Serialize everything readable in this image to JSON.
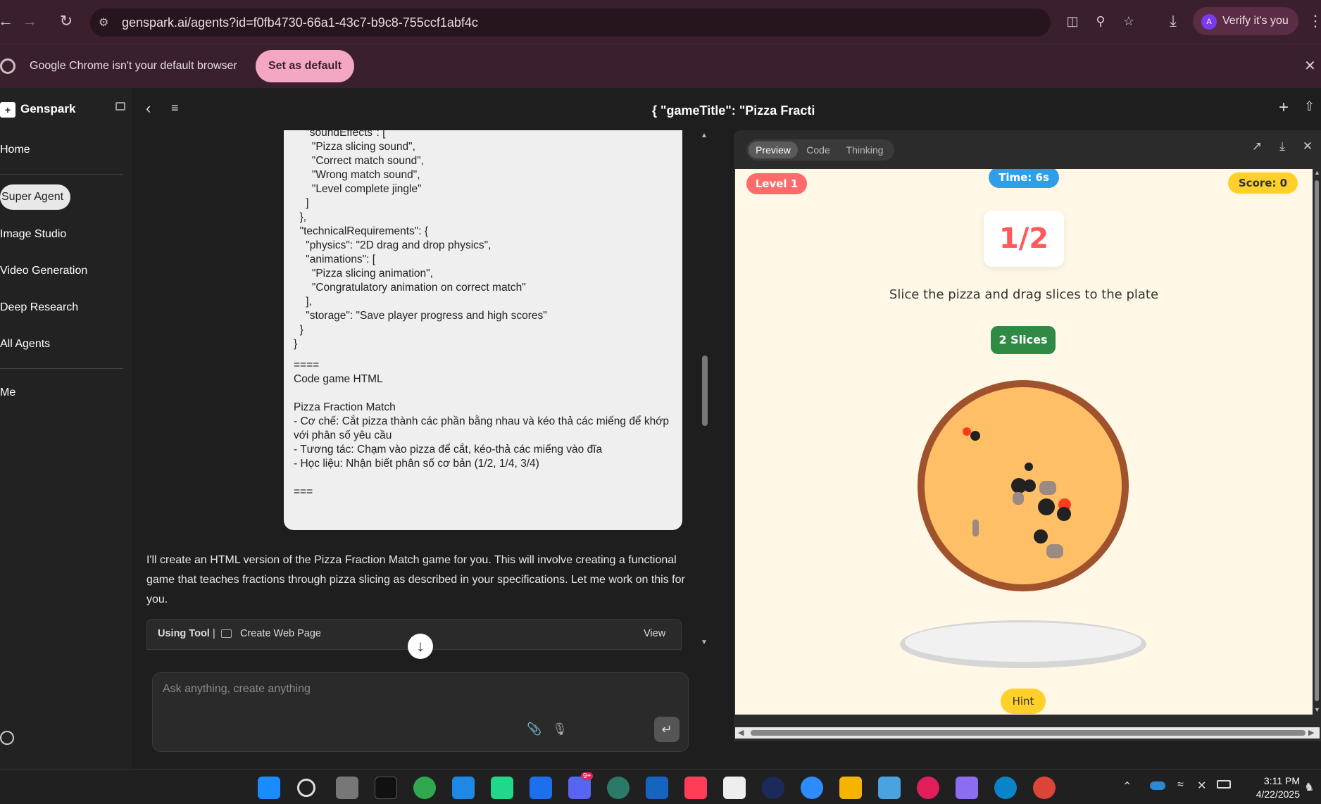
{
  "browser": {
    "url": "genspark.ai/agents?id=f0fb4730-66a1-43c7-b9c8-755ccf1abf4c",
    "verify_label": "Verify it's you",
    "verify_avatar": "A",
    "banner_text": "Google Chrome isn't your default browser",
    "set_default_label": "Set as default"
  },
  "sidebar": {
    "brand": "Genspark",
    "items": [
      {
        "label": "Home"
      },
      {
        "label": "Super Agent"
      },
      {
        "label": "Image Studio"
      },
      {
        "label": "Video Generation"
      },
      {
        "label": "Deep Research"
      },
      {
        "label": "All Agents"
      },
      {
        "label": "Me"
      }
    ]
  },
  "header": {
    "title": "{ \"gameTitle\": \"Pizza Fracti"
  },
  "chat": {
    "code_text": "    \"soundEffects\": [\n      \"Pizza slicing sound\",\n      \"Correct match sound\",\n      \"Wrong match sound\",\n      \"Level complete jingle\"\n    ]\n  },\n  \"technicalRequirements\": {\n    \"physics\": \"2D drag and drop physics\",\n    \"animations\": [\n      \"Pizza slicing animation\",\n      \"Congratulatory animation on correct match\"\n    ],\n    \"storage\": \"Save player progress and high scores\"\n  }\n}",
    "note_text": "====\nCode game HTML\n\nPizza Fraction Match\n- Cơ chế: Cắt pizza thành các phần bằng nhau và kéo thả các miếng để khớp với phân số yêu cầu\n- Tương tác: Chạm vào pizza để cắt, kéo-thả các miếng vào đĩa\n- Học liệu: Nhận biết phân số cơ bản (1/2, 1/4, 3/4)\n\n===",
    "assistant_message": "I'll create an HTML version of the Pizza Fraction Match game for you. This will involve creating a functional game that teaches fractions through pizza slicing as described in your specifications. Let me work on this for you.",
    "tool_using_label": "Using Tool",
    "tool_separator": "|",
    "tool_name": "Create Web Page",
    "tool_view_label": "View",
    "composer_placeholder": "Ask anything, create anything"
  },
  "preview": {
    "tabs": [
      {
        "label": "Preview"
      },
      {
        "label": "Code"
      },
      {
        "label": "Thinking"
      }
    ],
    "game": {
      "level": "Level 1",
      "time": "Time: 6s",
      "score": "Score: 0",
      "fraction": "1/2",
      "instruction": "Slice the pizza and drag slices to the plate",
      "slices_button": "2 Slices",
      "hint_button": "Hint"
    }
  },
  "taskbar": {
    "time": "3:11 PM",
    "date": "4/22/2025",
    "discord_badge": "9+"
  },
  "colors": {
    "browser_chrome": "#3a1f2e",
    "set_default_pink": "#f4a7c4",
    "level_red": "#ff6b6b",
    "time_blue": "#2e9fe6",
    "score_yellow": "#ffd02a",
    "slices_green": "#2f8a44",
    "pizza_cheese": "#ffbf66",
    "pizza_crust": "#a0522d"
  }
}
